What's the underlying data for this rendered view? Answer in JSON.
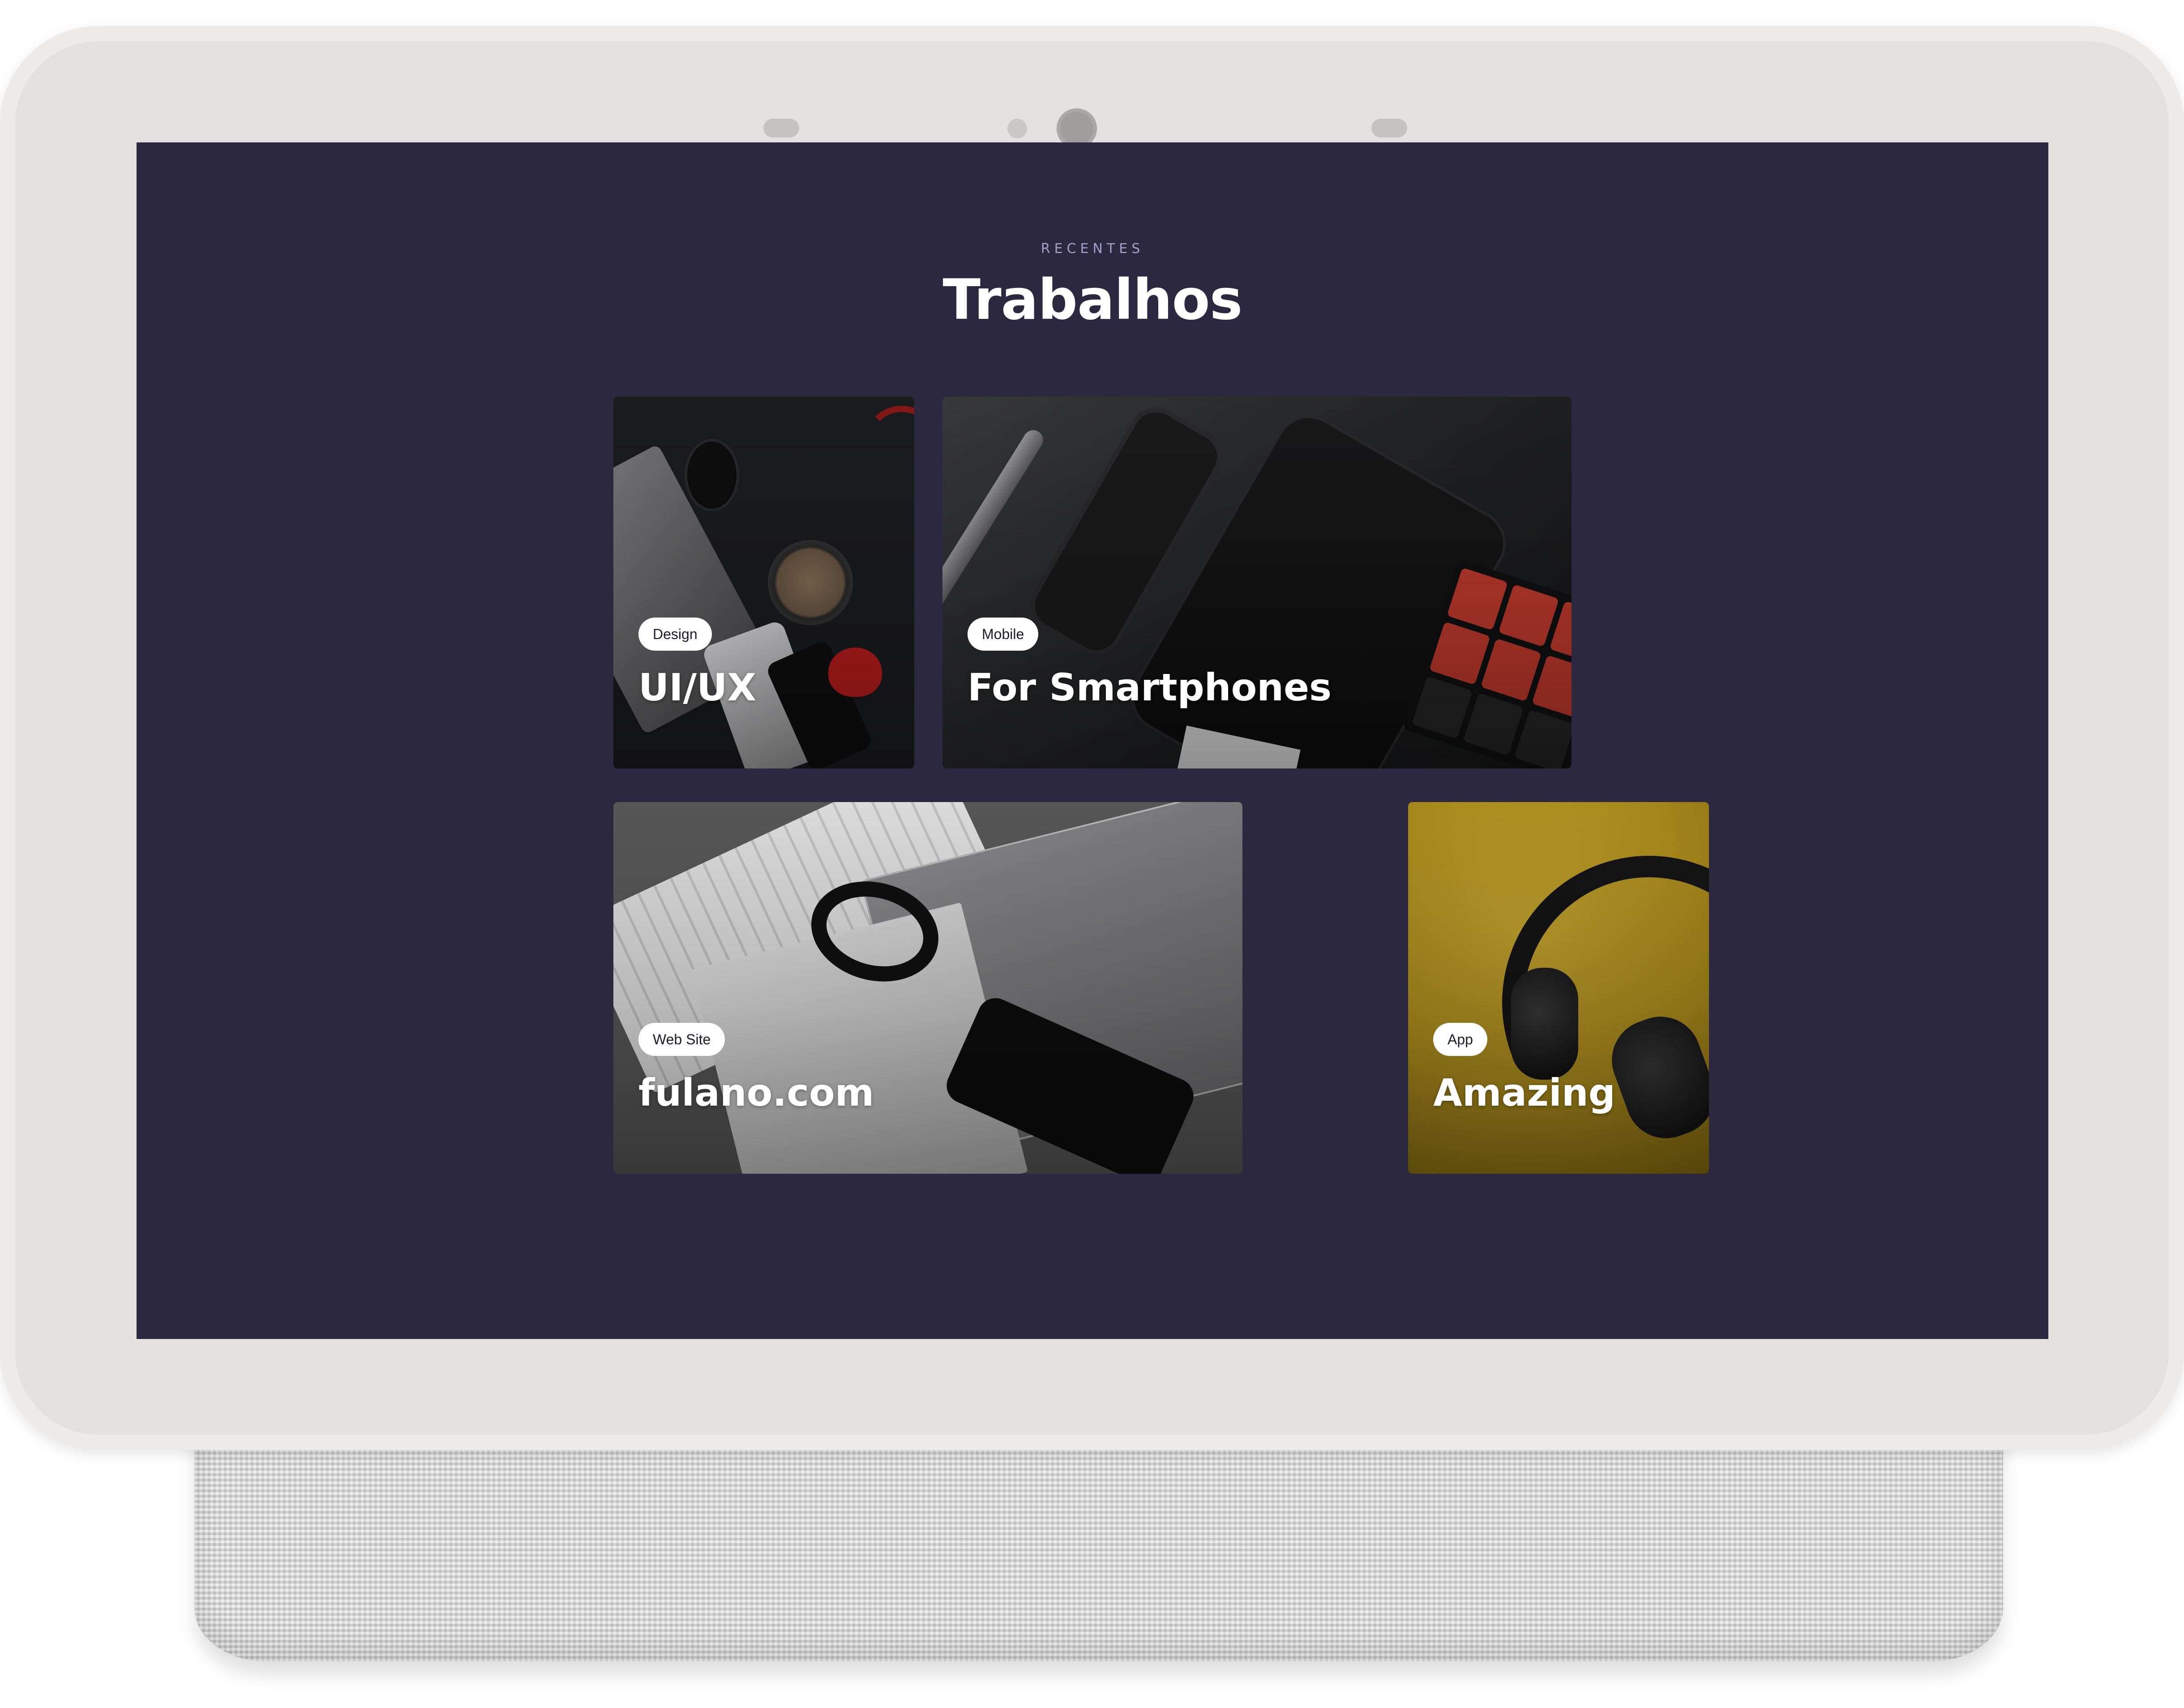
{
  "section": {
    "eyebrow": "RECENTES",
    "title": "Trabalhos"
  },
  "projects": [
    {
      "tag": "Design",
      "title": "UI/UX",
      "image": "desk-flat-lay-photo"
    },
    {
      "tag": "Mobile",
      "title": "For Smartphones",
      "image": "smartphones-rubik-cube-photo"
    },
    {
      "tag": "Web Site",
      "title": "fulano.com",
      "image": "macbook-watch-box-photo"
    },
    {
      "tag": "App",
      "title": "Amazing",
      "image": "headphones-yellow-photo"
    }
  ],
  "colors": {
    "screen_background": "#2c2840",
    "eyebrow": "#a3a0c8",
    "title": "#ffffff",
    "tag_background": "#ffffff",
    "tag_text": "#1d1b2c",
    "device_frame": "#e2e1df"
  },
  "device": {
    "icons": [
      "microphone-icon",
      "light-sensor-icon",
      "camera-icon",
      "microphone-icon"
    ]
  }
}
